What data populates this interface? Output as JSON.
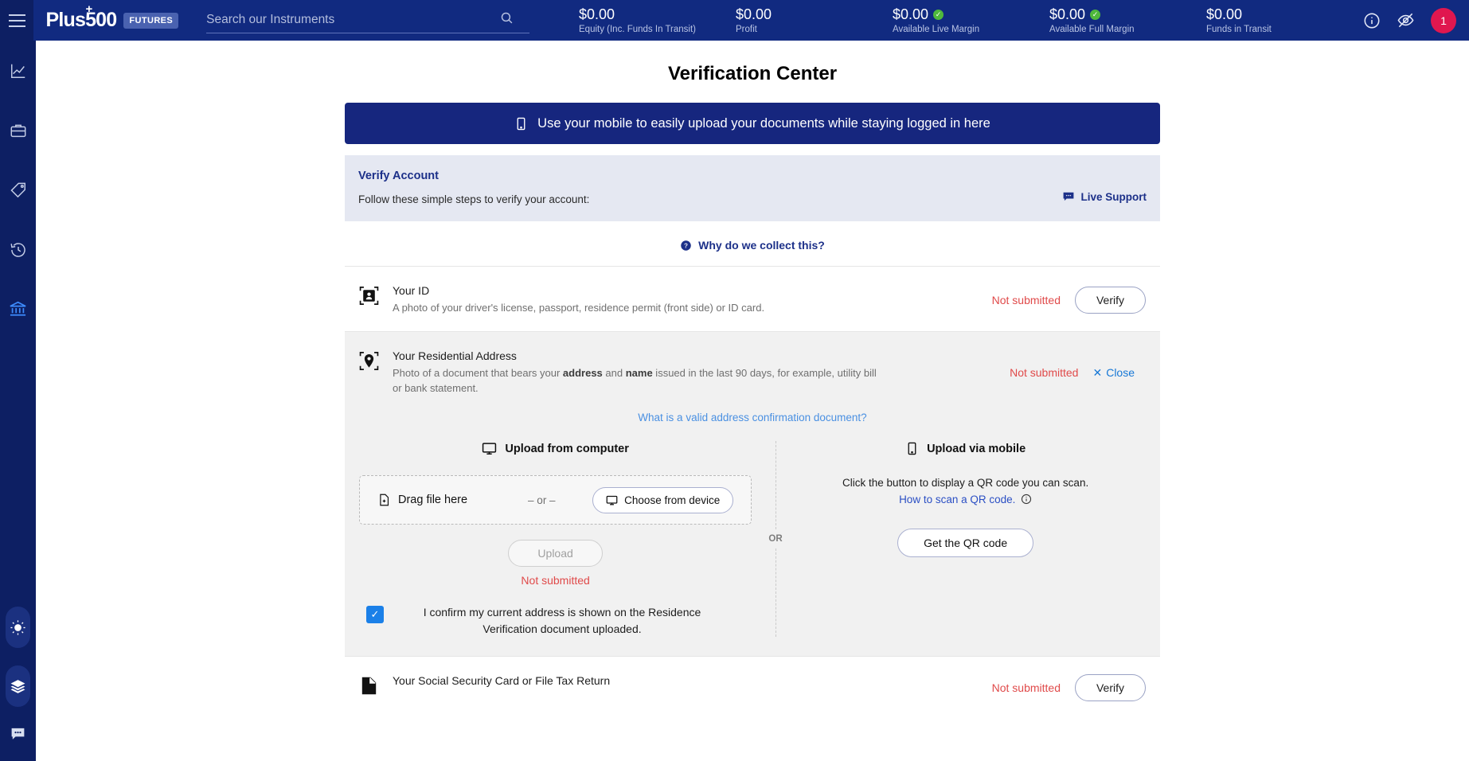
{
  "header": {
    "logo_text": "Plus500",
    "logo_plus": "+",
    "logo_badge": "FUTURES",
    "search_placeholder": "Search our Instruments",
    "search_value": "",
    "stats": [
      {
        "value": "$0.00",
        "label": "Equity (Inc. Funds In Transit)",
        "verified": false
      },
      {
        "value": "$0.00",
        "label": "Profit",
        "verified": false
      },
      {
        "value": "$0.00",
        "label": "Available Live Margin",
        "verified": true
      },
      {
        "value": "$0.00",
        "label": "Available Full Margin",
        "verified": true
      },
      {
        "value": "$0.00",
        "label": "Funds in Transit",
        "verified": false
      }
    ],
    "avatar_badge": "1"
  },
  "sidebar": {
    "items": [
      {
        "name": "chart-icon",
        "active": false
      },
      {
        "name": "briefcase-icon",
        "active": false
      },
      {
        "name": "tag-icon",
        "active": false
      },
      {
        "name": "history-clock-icon",
        "active": false
      },
      {
        "name": "bank-icon",
        "active": true
      }
    ],
    "bottom": [
      {
        "name": "brightness-sun-icon"
      },
      {
        "name": "layers-stack-icon"
      },
      {
        "name": "chat-bubble-icon"
      }
    ]
  },
  "page": {
    "title": "Verification Center",
    "mobile_banner": "Use your mobile to easily upload your documents while staying logged in here",
    "verify_panel": {
      "title": "Verify Account",
      "subtitle": "Follow these simple steps to verify your account:",
      "live_support": "Live Support"
    },
    "why_collect": "Why do we collect this?"
  },
  "documents": [
    {
      "icon": "id-card-icon",
      "title": "Your ID",
      "description": "A photo of your driver's license, passport, residence permit (front side) or ID card.",
      "status": "Not submitted",
      "action": "Verify"
    },
    {
      "icon": "location-pin-icon",
      "title": "Your Residential Address",
      "description_part1": "Photo of a document that bears your ",
      "description_bold1": "address",
      "description_part2": " and ",
      "description_bold2": "name",
      "description_part3": " issued in the last 90 days, for example, utility bill or bank statement.",
      "status": "Not submitted",
      "action": "Close"
    },
    {
      "icon": "document-icon",
      "title": "Your Social Security Card or File Tax Return",
      "description": "",
      "status": "Not submitted",
      "action": "Verify"
    }
  ],
  "upload": {
    "valid_doc_link": "What is a valid address confirmation document?",
    "computer": {
      "heading": "Upload from computer",
      "drag_label": "Drag file here",
      "or_label": "– or –",
      "choose_label": "Choose from device",
      "upload_button": "Upload",
      "status": "Not submitted",
      "confirm_text": "I confirm my current address is shown on the Residence Verification document uploaded.",
      "confirm_checked": true
    },
    "divider_label": "OR",
    "mobile": {
      "heading": "Upload via mobile",
      "desc_line1": "Click the button to display a QR code you can scan.",
      "desc_link": "How to scan a QR code.",
      "qr_button": "Get the QR code"
    }
  },
  "colors": {
    "brand_blue": "#112a80",
    "sidebar_blue": "#0d1f63",
    "banner_blue": "#16267e",
    "panel_blue": "#e5e8f2",
    "link_blue": "#1778d6",
    "status_red": "#e04a4a",
    "check_green": "#4fb83c",
    "avatar_red": "#e0174f",
    "checkbox_blue": "#1b80e8",
    "active_icon": "#3d8bfd"
  }
}
